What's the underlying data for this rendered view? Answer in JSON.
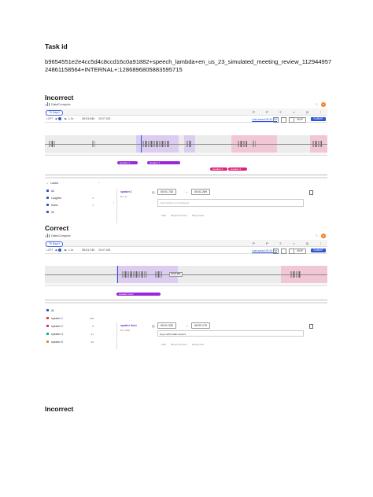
{
  "headings": {
    "task_id": "Task id",
    "incorrect_1": "Incorrect",
    "correct": "Correct",
    "incorrect_2": "Incorrect"
  },
  "task_text": "b9654551e2e4cc5d4c8ccd16c0a91882+speech_lambda+en_us_23_simulated_meeting_review_11294495724861158564+INTERNAL+:1286896805883595715",
  "shot_incorrect": {
    "brand": "DataCompute",
    "avatar_letter": "M",
    "days_pill": "76 Days+",
    "toolbar_left": "LOFT",
    "speed": "1.0x",
    "time_current": "00:01:040",
    "time_total": "26:07.625",
    "saved": "Last saved 05:34 PM",
    "skip_label": "SKIP",
    "submit_label": "SUBMIT",
    "chips": [
      "speaker 1",
      "speaker 1",
      "speaker 2"
    ],
    "labels_header": "Labels",
    "labels": [
      "All",
      "Laughter",
      "Noise",
      "Sil"
    ],
    "counts": [
      "",
      "2",
      "1",
      ""
    ],
    "card_speaker": "speaker 1",
    "card_sub": "No: 21",
    "start_time": "00:01.730",
    "end_time": "00:02.289",
    "placeholder": "Transcription not displayed",
    "actions": [
      "Split",
      "Merge Previous",
      "Merge Next"
    ]
  },
  "shot_correct": {
    "brand": "DataCompute",
    "avatar_letter": "M",
    "days_pill": "76 Days+",
    "toolbar_left": "LOFT",
    "speed": "1.0x",
    "time_current": "00:01.740",
    "time_total": "26:07.625",
    "saved": "Last saved 05:34 PM",
    "skip_label": "SKIP",
    "submit_label": "SUBMIT",
    "chips": [
      "speaker Gunz"
    ],
    "hover_tag": "00:01.360",
    "labels": [
      "All",
      "speaker 1",
      "speaker 2",
      "speaker 4",
      "speaker 5"
    ],
    "counts": [
      "",
      "128",
      "8",
      "41",
      "39"
    ],
    "card_speaker": "speaker Gunz",
    "card_sub": "No Label",
    "start_time": "00:01.330",
    "end_time": "00:03.179",
    "transcript": "Guys with Indian accent.",
    "actions": [
      "Split",
      "Merge Previous",
      "Merge Next"
    ]
  }
}
